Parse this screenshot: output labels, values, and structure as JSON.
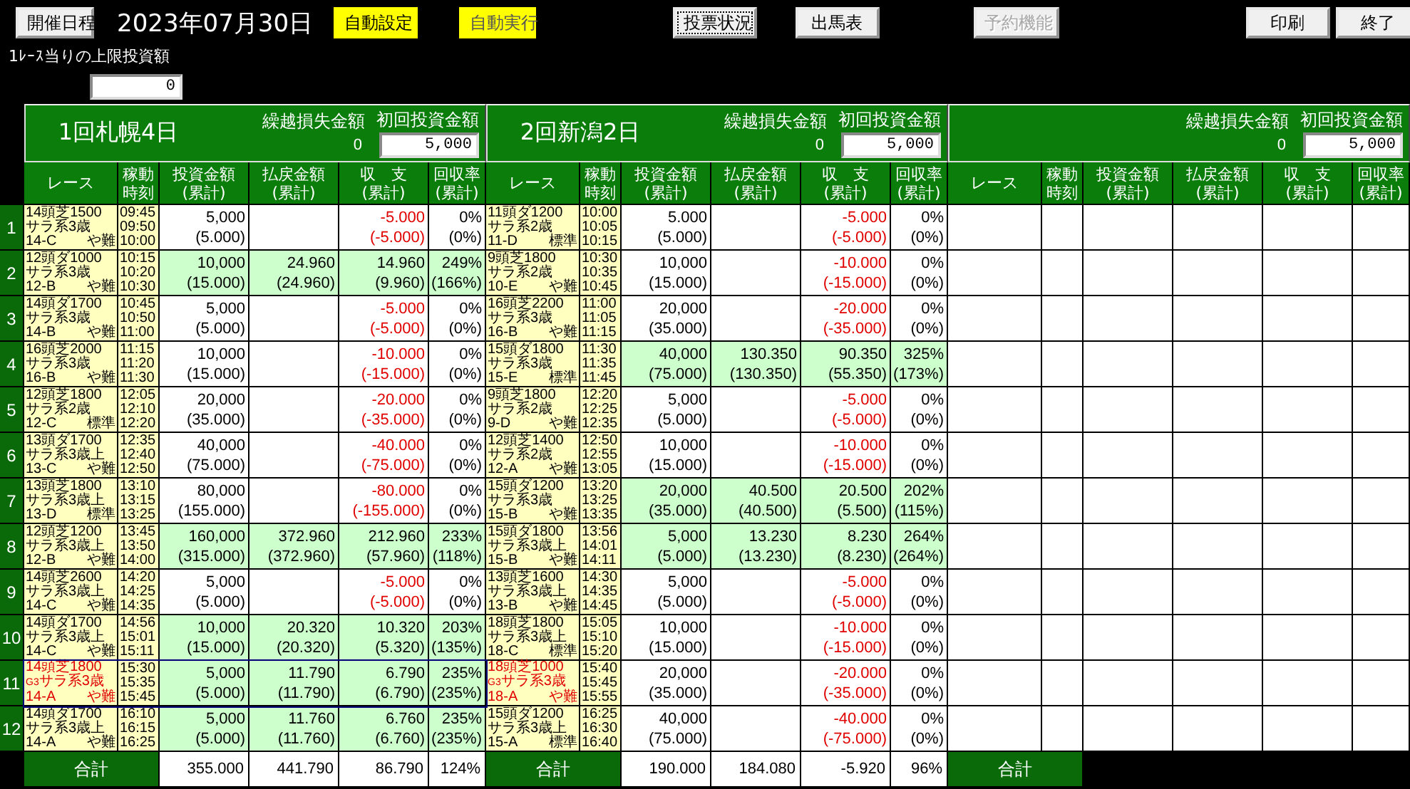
{
  "toolbar": [
    {
      "label": "開催日程",
      "kind": "plain",
      "disabled": false
    },
    {
      "label": "2023年07月30日",
      "kind": "date"
    },
    {
      "label": "自動設定",
      "kind": "yellow",
      "disabled": false
    },
    {
      "label": "自動実行",
      "kind": "yellow",
      "disabled": true
    },
    {
      "label": "投票状況",
      "kind": "focused",
      "disabled": false
    },
    {
      "label": "出馬表",
      "kind": "plain",
      "disabled": false
    },
    {
      "label": "予約機能",
      "kind": "plain",
      "disabled": true
    },
    {
      "label": "印刷",
      "kind": "plain",
      "disabled": false
    },
    {
      "label": "終了",
      "kind": "plain",
      "disabled": false
    }
  ],
  "limit": {
    "label": "1ﾚｰｽ当りの上限投資額",
    "value": "0"
  },
  "row_numbers": [
    "1",
    "2",
    "3",
    "4",
    "5",
    "6",
    "7",
    "8",
    "9",
    "10",
    "11",
    "12"
  ],
  "panels": [
    {
      "title": "1回札幌4日",
      "carryover_label": "繰越損失金額",
      "carryover": "0",
      "initial_label": "初回投資金額",
      "initial": "5,000",
      "columns": [
        [
          "レース"
        ],
        [
          "稼動",
          "時刻"
        ],
        [
          "投資金額",
          "(累計)"
        ],
        [
          "払戻金額",
          "(累計)"
        ],
        [
          "収　支",
          "(累計)"
        ],
        [
          "回収率",
          "(累計)"
        ]
      ],
      "rows": [
        {
          "race": [
            "14頭芝1500",
            "サラ系3歳"
          ],
          "course": "14-C",
          "track": "や難",
          "times": [
            "09:45",
            "09:50",
            "10:00"
          ],
          "invest": "5,000",
          "invest_total": "(5.000)",
          "balance": "-5.000",
          "balance_total": "(-5.000)",
          "loss": true,
          "rate": "0%",
          "rate_total": "(0%)",
          "hit": false,
          "selected": false
        },
        {
          "race": [
            "12頭ダ1000",
            "サラ系3歳"
          ],
          "course": "12-B",
          "track": "や難",
          "times": [
            "10:15",
            "10:20",
            "10:30"
          ],
          "invest": "10,000",
          "invest_total": "(15.000)",
          "payout": "24.960",
          "payout_total": "(24.960)",
          "balance": "14.960",
          "balance_total": "(9.960)",
          "loss": false,
          "rate": "249%",
          "rate_total": "(166%)",
          "hit": true,
          "selected": false
        },
        {
          "race": [
            "14頭ダ1700",
            "サラ系3歳"
          ],
          "course": "14-B",
          "track": "や難",
          "times": [
            "10:45",
            "10:50",
            "11:00"
          ],
          "invest": "5,000",
          "invest_total": "(5.000)",
          "balance": "-5.000",
          "balance_total": "(-5.000)",
          "loss": true,
          "rate": "0%",
          "rate_total": "(0%)",
          "hit": false,
          "selected": false
        },
        {
          "race": [
            "16頭芝2000",
            "サラ系3歳"
          ],
          "course": "16-B",
          "track": "や難",
          "times": [
            "11:15",
            "11:20",
            "11:30"
          ],
          "invest": "10,000",
          "invest_total": "(15.000)",
          "balance": "-10.000",
          "balance_total": "(-15.000)",
          "loss": true,
          "rate": "0%",
          "rate_total": "(0%)",
          "hit": false,
          "selected": false
        },
        {
          "race": [
            "12頭芝1800",
            "サラ系2歳"
          ],
          "course": "12-C",
          "track": "標準",
          "times": [
            "12:05",
            "12:10",
            "12:20"
          ],
          "invest": "20,000",
          "invest_total": "(35.000)",
          "balance": "-20.000",
          "balance_total": "(-35.000)",
          "loss": true,
          "rate": "0%",
          "rate_total": "(0%)",
          "hit": false,
          "selected": false
        },
        {
          "race": [
            "13頭ダ1700",
            "サラ系3歳上"
          ],
          "course": "13-C",
          "track": "や難",
          "times": [
            "12:35",
            "12:40",
            "12:50"
          ],
          "invest": "40,000",
          "invest_total": "(75.000)",
          "balance": "-40.000",
          "balance_total": "(-75.000)",
          "loss": true,
          "rate": "0%",
          "rate_total": "(0%)",
          "hit": false,
          "selected": false
        },
        {
          "race": [
            "13頭芝1800",
            "サラ系3歳上"
          ],
          "course": "13-D",
          "track": "標準",
          "times": [
            "13:10",
            "13:15",
            "13:25"
          ],
          "invest": "80,000",
          "invest_total": "(155.000)",
          "balance": "-80.000",
          "balance_total": "(-155.000)",
          "loss": true,
          "rate": "0%",
          "rate_total": "(0%)",
          "hit": false,
          "selected": false
        },
        {
          "race": [
            "12頭芝1200",
            "サラ系3歳上"
          ],
          "course": "12-B",
          "track": "や難",
          "times": [
            "13:45",
            "13:50",
            "14:00"
          ],
          "invest": "160,000",
          "invest_total": "(315.000)",
          "payout": "372.960",
          "payout_total": "(372.960)",
          "balance": "212.960",
          "balance_total": "(57.960)",
          "loss": false,
          "rate": "233%",
          "rate_total": "(118%)",
          "hit": true,
          "selected": false
        },
        {
          "race": [
            "14頭芝2600",
            "サラ系3歳上"
          ],
          "course": "14-C",
          "track": "や難",
          "times": [
            "14:20",
            "14:25",
            "14:35"
          ],
          "invest": "5,000",
          "invest_total": "(5.000)",
          "balance": "-5.000",
          "balance_total": "(-5.000)",
          "loss": true,
          "rate": "0%",
          "rate_total": "(0%)",
          "hit": false,
          "selected": false
        },
        {
          "race": [
            "14頭ダ1700",
            "サラ系3歳上"
          ],
          "course": "14-C",
          "track": "や難",
          "times": [
            "14:56",
            "15:01",
            "15:11"
          ],
          "invest": "10,000",
          "invest_total": "(15.000)",
          "payout": "20.320",
          "payout_total": "(20.320)",
          "balance": "10.320",
          "balance_total": "(5.320)",
          "loss": false,
          "rate": "203%",
          "rate_total": "(135%)",
          "hit": true,
          "selected": false
        },
        {
          "race": [
            "14頭芝1800",
            "サラ系3歳"
          ],
          "grade": "G3",
          "course": "14-A",
          "track": "や難",
          "times": [
            "15:30",
            "15:35",
            "15:45"
          ],
          "invest": "5,000",
          "invest_total": "(5.000)",
          "payout": "11.790",
          "payout_total": "(11.790)",
          "balance": "6.790",
          "balance_total": "(6.790)",
          "loss": false,
          "rate": "235%",
          "rate_total": "(235%)",
          "hit": true,
          "selected": true
        },
        {
          "race": [
            "14頭ダ1700",
            "サラ系3歳上"
          ],
          "course": "14-A",
          "track": "や難",
          "times": [
            "16:10",
            "16:15",
            "16:25"
          ],
          "invest": "5,000",
          "invest_total": "(5.000)",
          "payout": "11.760",
          "payout_total": "(11.760)",
          "balance": "6.760",
          "balance_total": "(6.760)",
          "loss": false,
          "rate": "235%",
          "rate_total": "(235%)",
          "hit": true,
          "selected": false
        }
      ],
      "total": {
        "label": "合計",
        "invest": "355.000",
        "payout": "441.790",
        "balance": "86.790",
        "rate": "124%"
      }
    },
    {
      "title": "2回新潟2日",
      "carryover_label": "繰越損失金額",
      "carryover": "0",
      "initial_label": "初回投資金額",
      "initial": "5,000",
      "columns": [
        [
          "レース"
        ],
        [
          "稼動",
          "時刻"
        ],
        [
          "投資金額",
          "(累計)"
        ],
        [
          "払戻金額",
          "(累計)"
        ],
        [
          "収　支",
          "(累計)"
        ],
        [
          "回収率",
          "(累計)"
        ]
      ],
      "rows": [
        {
          "race": [
            "11頭ダ1200",
            "サラ系2歳"
          ],
          "course": "11-D",
          "track": "標準",
          "times": [
            "10:00",
            "10:05",
            "10:15"
          ],
          "invest": "5.000",
          "invest_total": "(5.000)",
          "balance": "-5.000",
          "balance_total": "(-5.000)",
          "loss": true,
          "rate": "0%",
          "rate_total": "(0%)",
          "hit": false,
          "selected": false
        },
        {
          "race": [
            "9頭芝1800",
            "サラ系2歳"
          ],
          "course": "10-E",
          "track": "や難",
          "times": [
            "10:30",
            "10:35",
            "10:45"
          ],
          "invest": "10,000",
          "invest_total": "(15.000)",
          "balance": "-10.000",
          "balance_total": "(-15.000)",
          "loss": true,
          "rate": "0%",
          "rate_total": "(0%)",
          "hit": false,
          "selected": false
        },
        {
          "race": [
            "16頭芝2200",
            "サラ系3歳"
          ],
          "course": "16-B",
          "track": "や難",
          "times": [
            "11:00",
            "11:05",
            "11:15"
          ],
          "invest": "20,000",
          "invest_total": "(35.000)",
          "balance": "-20.000",
          "balance_total": "(-35.000)",
          "loss": true,
          "rate": "0%",
          "rate_total": "(0%)",
          "hit": false,
          "selected": false
        },
        {
          "race": [
            "15頭ダ1800",
            "サラ系3歳"
          ],
          "course": "15-E",
          "track": "標準",
          "times": [
            "11:30",
            "11:35",
            "11:45"
          ],
          "invest": "40,000",
          "invest_total": "(75.000)",
          "payout": "130.350",
          "payout_total": "(130.350)",
          "balance": "90.350",
          "balance_total": "(55.350)",
          "loss": false,
          "rate": "325%",
          "rate_total": "(173%)",
          "hit": true,
          "selected": false
        },
        {
          "race": [
            "9頭芝1800",
            "サラ系2歳"
          ],
          "course": "9-D",
          "track": "や難",
          "times": [
            "12:20",
            "12:25",
            "12:35"
          ],
          "invest": "5,000",
          "invest_total": "(5.000)",
          "balance": "-5.000",
          "balance_total": "(-5.000)",
          "loss": true,
          "rate": "0%",
          "rate_total": "(0%)",
          "hit": false,
          "selected": false
        },
        {
          "race": [
            "12頭芝1400",
            "サラ系2歳"
          ],
          "course": "12-A",
          "track": "や難",
          "times": [
            "12:50",
            "12:55",
            "13:05"
          ],
          "invest": "10,000",
          "invest_total": "(15.000)",
          "balance": "-10.000",
          "balance_total": "(-15.000)",
          "loss": true,
          "rate": "0%",
          "rate_total": "(0%)",
          "hit": false,
          "selected": false
        },
        {
          "race": [
            "15頭ダ1200",
            "サラ系3歳"
          ],
          "course": "15-B",
          "track": "や難",
          "times": [
            "13:20",
            "13:25",
            "13:35"
          ],
          "invest": "20,000",
          "invest_total": "(35.000)",
          "payout": "40.500",
          "payout_total": "(40.500)",
          "balance": "20.500",
          "balance_total": "(5.500)",
          "loss": false,
          "rate": "202%",
          "rate_total": "(115%)",
          "hit": true,
          "selected": false
        },
        {
          "race": [
            "15頭ダ1800",
            "サラ系3歳上"
          ],
          "course": "15-B",
          "track": "や難",
          "times": [
            "13:56",
            "14:01",
            "14:11"
          ],
          "invest": "5,000",
          "invest_total": "(5.000)",
          "payout": "13.230",
          "payout_total": "(13.230)",
          "balance": "8.230",
          "balance_total": "(8.230)",
          "loss": false,
          "rate": "264%",
          "rate_total": "(264%)",
          "hit": true,
          "selected": false
        },
        {
          "race": [
            "13頭芝1600",
            "サラ系3歳上"
          ],
          "course": "13-B",
          "track": "や難",
          "times": [
            "14:30",
            "14:35",
            "14:45"
          ],
          "invest": "5,000",
          "invest_total": "(5.000)",
          "balance": "-5.000",
          "balance_total": "(-5.000)",
          "loss": true,
          "rate": "0%",
          "rate_total": "(0%)",
          "hit": false,
          "selected": false
        },
        {
          "race": [
            "18頭芝1800",
            "サラ系3歳上"
          ],
          "course": "18-C",
          "track": "標準",
          "times": [
            "15:05",
            "15:10",
            "15:20"
          ],
          "invest": "10,000",
          "invest_total": "(15.000)",
          "balance": "-10.000",
          "balance_total": "(-15.000)",
          "loss": true,
          "rate": "0%",
          "rate_total": "(0%)",
          "hit": false,
          "selected": false
        },
        {
          "race": [
            "18頭芝1000",
            "サラ系3歳"
          ],
          "grade": "G3",
          "course": "18-A",
          "track": "や難",
          "times": [
            "15:40",
            "15:45",
            "15:55"
          ],
          "invest": "20,000",
          "invest_total": "(35.000)",
          "balance": "-20.000",
          "balance_total": "(-35.000)",
          "loss": true,
          "rate": "0%",
          "rate_total": "(0%)",
          "hit": false,
          "selected": false
        },
        {
          "race": [
            "15頭ダ1200",
            "サラ系3歳上"
          ],
          "course": "15-A",
          "track": "標準",
          "times": [
            "16:25",
            "16:30",
            "16:40"
          ],
          "invest": "40,000",
          "invest_total": "(75.000)",
          "balance": "-40.000",
          "balance_total": "(-75.000)",
          "loss": true,
          "rate": "0%",
          "rate_total": "(0%)",
          "hit": false,
          "selected": false
        }
      ],
      "total": {
        "label": "合計",
        "invest": "190.000",
        "payout": "184.080",
        "balance": "-5.920",
        "rate": "96%"
      }
    },
    {
      "carryover_label": "繰越損失金額",
      "carryover": "0",
      "initial_label": "初回投資金額",
      "initial": "5,000",
      "columns": [
        [
          "レース"
        ],
        [
          "稼動",
          "時刻"
        ],
        [
          "投資金額",
          "(累計)"
        ],
        [
          "払戻金額",
          "(累計)"
        ],
        [
          "収　支",
          "(累計)"
        ],
        [
          "回収率",
          "(累計)"
        ]
      ],
      "total": {
        "label": "合計"
      }
    }
  ]
}
